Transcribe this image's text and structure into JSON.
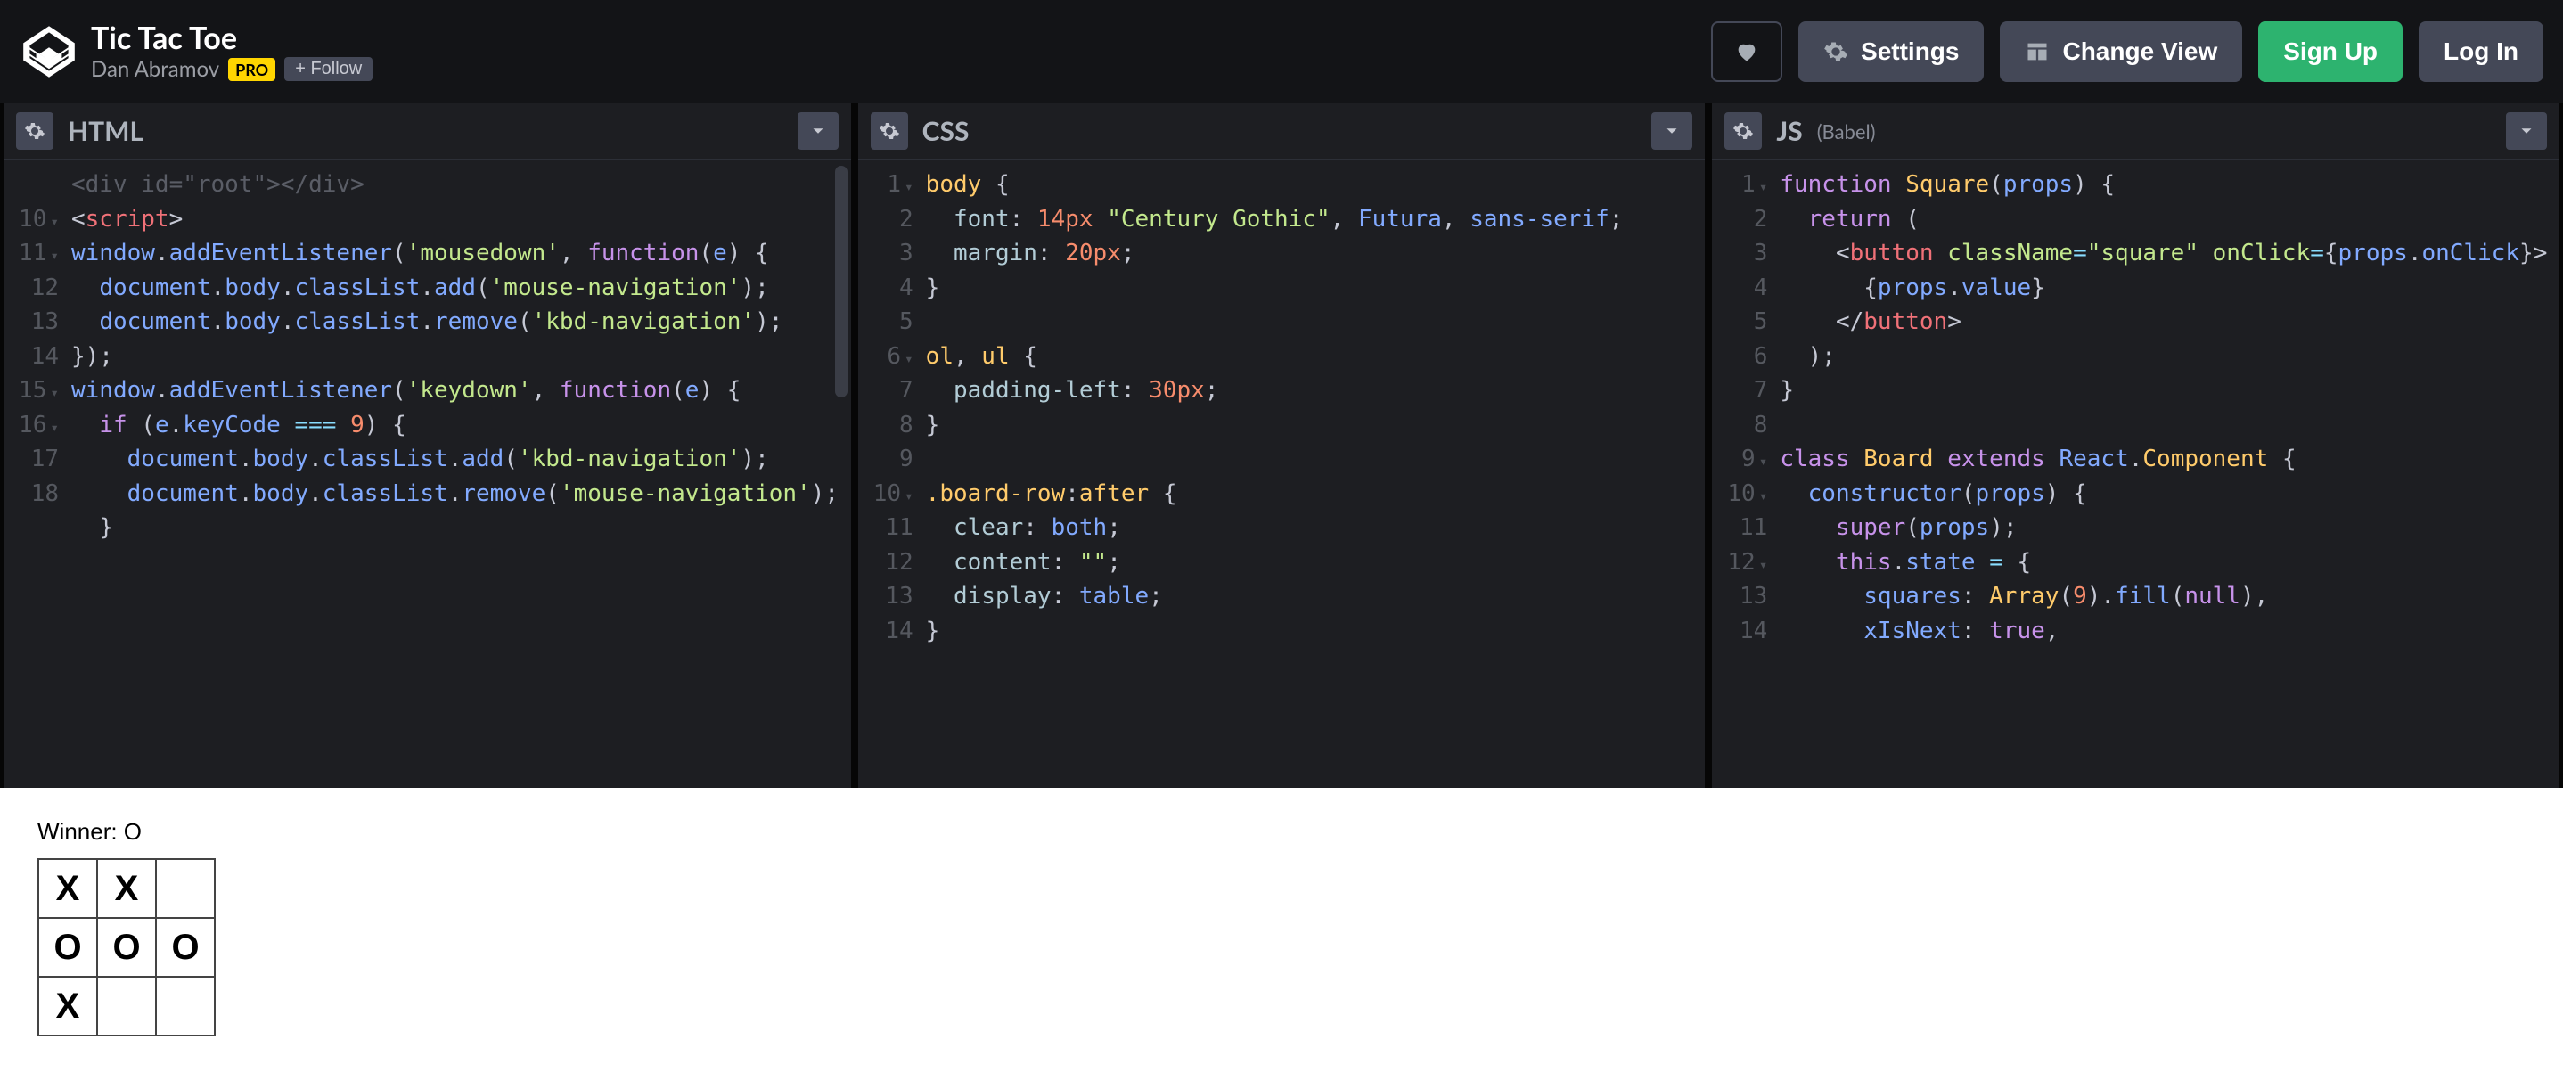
{
  "header": {
    "title": "Tic Tac Toe",
    "author": "Dan Abramov",
    "pro_badge": "PRO",
    "follow_label": "+ Follow",
    "settings_label": "Settings",
    "change_view_label": "Change View",
    "signup_label": "Sign Up",
    "login_label": "Log In"
  },
  "panes": {
    "html": {
      "label": "HTML"
    },
    "css": {
      "label": "CSS"
    },
    "js": {
      "label": "JS",
      "sublabel": "(Babel)"
    }
  },
  "code": {
    "html": {
      "gutter": [
        "",
        "10",
        "11",
        "12",
        "13",
        "14",
        "15",
        "16",
        "17",
        "18",
        ""
      ],
      "gutter_fold_rows": [
        1,
        2,
        6,
        7
      ],
      "lines_html": [
        "<span class='tk-grey'>&lt;div id=\"root\"&gt;&lt;/div&gt;</span>",
        "<span class='tk-punc'>&lt;</span><span class='tk-tag'>script</span><span class='tk-punc'>&gt;</span>",
        "<span class='tk-var'>window</span><span class='tk-punc'>.</span><span class='tk-meth'>addEventListener</span><span class='tk-punc'>(</span><span class='tk-str'>'mousedown'</span><span class='tk-punc'>, </span><span class='tk-kw'>function</span><span class='tk-punc'>(</span><span class='tk-var'>e</span><span class='tk-punc'>) {</span>",
        "  <span class='tk-var'>document</span><span class='tk-punc'>.</span><span class='tk-var'>body</span><span class='tk-punc'>.</span><span class='tk-var'>classList</span><span class='tk-punc'>.</span><span class='tk-meth'>add</span><span class='tk-punc'>(</span><span class='tk-str'>'mouse-navigation'</span><span class='tk-punc'>);</span>",
        "  <span class='tk-var'>document</span><span class='tk-punc'>.</span><span class='tk-var'>body</span><span class='tk-punc'>.</span><span class='tk-var'>classList</span><span class='tk-punc'>.</span><span class='tk-meth'>remove</span><span class='tk-punc'>(</span><span class='tk-str'>'kbd-navigation'</span><span class='tk-punc'>);</span>",
        "<span class='tk-punc'>});</span>",
        "<span class='tk-var'>window</span><span class='tk-punc'>.</span><span class='tk-meth'>addEventListener</span><span class='tk-punc'>(</span><span class='tk-str'>'keydown'</span><span class='tk-punc'>, </span><span class='tk-kw'>function</span><span class='tk-punc'>(</span><span class='tk-var'>e</span><span class='tk-punc'>) {</span>",
        "  <span class='tk-kw'>if</span><span class='tk-punc'> (</span><span class='tk-var'>e</span><span class='tk-punc'>.</span><span class='tk-var'>keyCode</span> <span class='tk-op'>===</span> <span class='tk-num'>9</span><span class='tk-punc'>) {</span>",
        "    <span class='tk-var'>document</span><span class='tk-punc'>.</span><span class='tk-var'>body</span><span class='tk-punc'>.</span><span class='tk-var'>classList</span><span class='tk-punc'>.</span><span class='tk-meth'>add</span><span class='tk-punc'>(</span><span class='tk-str'>'kbd-navigation'</span><span class='tk-punc'>);</span>",
        "    <span class='tk-var'>document</span><span class='tk-punc'>.</span><span class='tk-var'>body</span><span class='tk-punc'>.</span><span class='tk-var'>classList</span><span class='tk-punc'>.</span><span class='tk-meth'>remove</span><span class='tk-punc'>(</span><span class='tk-str'>'mouse-navigation'</span><span class='tk-punc'>);</span>",
        "  <span class='tk-punc'>}</span>"
      ]
    },
    "css": {
      "gutter": [
        "1",
        "2",
        "3",
        "4",
        "5",
        "6",
        "7",
        "8",
        "9",
        "10",
        "11",
        "12",
        "13",
        "14"
      ],
      "gutter_fold_rows": [
        0,
        5,
        9
      ],
      "lines_html": [
        "<span class='tk-sel'>body</span> <span class='tk-punc'>{</span>",
        "  <span class='tk-prop'>font</span><span class='tk-punc'>:</span> <span class='tk-num'>14px</span> <span class='tk-str'>\"Century Gothic\"</span><span class='tk-punc'>,</span> <span class='tk-var'>Futura</span><span class='tk-punc'>,</span> <span class='tk-var'>sans-serif</span><span class='tk-punc'>;</span>",
        "  <span class='tk-prop'>margin</span><span class='tk-punc'>:</span> <span class='tk-num'>20px</span><span class='tk-punc'>;</span>",
        "<span class='tk-punc'>}</span>",
        "",
        "<span class='tk-sel'>ol</span><span class='tk-punc'>,</span> <span class='tk-sel'>ul</span> <span class='tk-punc'>{</span>",
        "  <span class='tk-prop'>padding-left</span><span class='tk-punc'>:</span> <span class='tk-num'>30px</span><span class='tk-punc'>;</span>",
        "<span class='tk-punc'>}</span>",
        "",
        "<span class='tk-sel'>.board-row</span><span class='tk-punc'>:</span><span class='tk-sel'>after</span> <span class='tk-punc'>{</span>",
        "  <span class='tk-prop'>clear</span><span class='tk-punc'>:</span> <span class='tk-var'>both</span><span class='tk-punc'>;</span>",
        "  <span class='tk-prop'>content</span><span class='tk-punc'>:</span> <span class='tk-str'>\"\"</span><span class='tk-punc'>;</span>",
        "  <span class='tk-prop'>display</span><span class='tk-punc'>:</span> <span class='tk-var'>table</span><span class='tk-punc'>;</span>",
        "<span class='tk-punc'>}</span>"
      ]
    },
    "js": {
      "gutter": [
        "1",
        "2",
        "3",
        "4",
        "5",
        "6",
        "7",
        "8",
        "9",
        "10",
        "11",
        "12",
        "13",
        "14"
      ],
      "gutter_fold_rows": [
        0,
        8,
        9,
        11
      ],
      "lines_html": [
        "<span class='tk-kw'>function</span> <span class='tk-cls'>Square</span><span class='tk-punc'>(</span><span class='tk-var'>props</span><span class='tk-punc'>) {</span>",
        "  <span class='tk-kw'>return</span> <span class='tk-punc'>(</span>",
        "    <span class='tk-punc'>&lt;</span><span class='tk-tag'>button</span> <span class='tk-attr'>className</span><span class='tk-op'>=</span><span class='tk-str'>\"square\"</span> <span class='tk-attr'>onClick</span><span class='tk-op'>=</span><span class='tk-punc'>{</span><span class='tk-var'>props</span><span class='tk-punc'>.</span><span class='tk-var'>onClick</span><span class='tk-punc'>}&gt;</span>",
        "      <span class='tk-punc'>{</span><span class='tk-var'>props</span><span class='tk-punc'>.</span><span class='tk-var'>value</span><span class='tk-punc'>}</span>",
        "    <span class='tk-punc'>&lt;/</span><span class='tk-tag'>button</span><span class='tk-punc'>&gt;</span>",
        "  <span class='tk-punc'>);</span>",
        "<span class='tk-punc'>}</span>",
        "",
        "<span class='tk-kw'>class</span> <span class='tk-cls'>Board</span> <span class='tk-kw'>extends</span> <span class='tk-var'>React</span><span class='tk-punc'>.</span><span class='tk-cls'>Component</span> <span class='tk-punc'>{</span>",
        "  <span class='tk-meth'>constructor</span><span class='tk-punc'>(</span><span class='tk-var'>props</span><span class='tk-punc'>) {</span>",
        "    <span class='tk-kw'>super</span><span class='tk-punc'>(</span><span class='tk-var'>props</span><span class='tk-punc'>);</span>",
        "    <span class='tk-kw'>this</span><span class='tk-punc'>.</span><span class='tk-var'>state</span> <span class='tk-op'>=</span> <span class='tk-punc'>{</span>",
        "      <span class='tk-var'>squares</span><span class='tk-punc'>:</span> <span class='tk-cls'>Array</span><span class='tk-punc'>(</span><span class='tk-num'>9</span><span class='tk-punc'>).</span><span class='tk-meth'>fill</span><span class='tk-punc'>(</span><span class='tk-kw'>null</span><span class='tk-punc'>),</span>",
        "      <span class='tk-var'>xIsNext</span><span class='tk-punc'>:</span> <span class='tk-kw'>true</span><span class='tk-punc'>,</span>"
      ]
    }
  },
  "result": {
    "status": "Winner: O",
    "board": [
      [
        "X",
        "X",
        ""
      ],
      [
        "O",
        "O",
        "O"
      ],
      [
        "X",
        "",
        ""
      ]
    ]
  }
}
